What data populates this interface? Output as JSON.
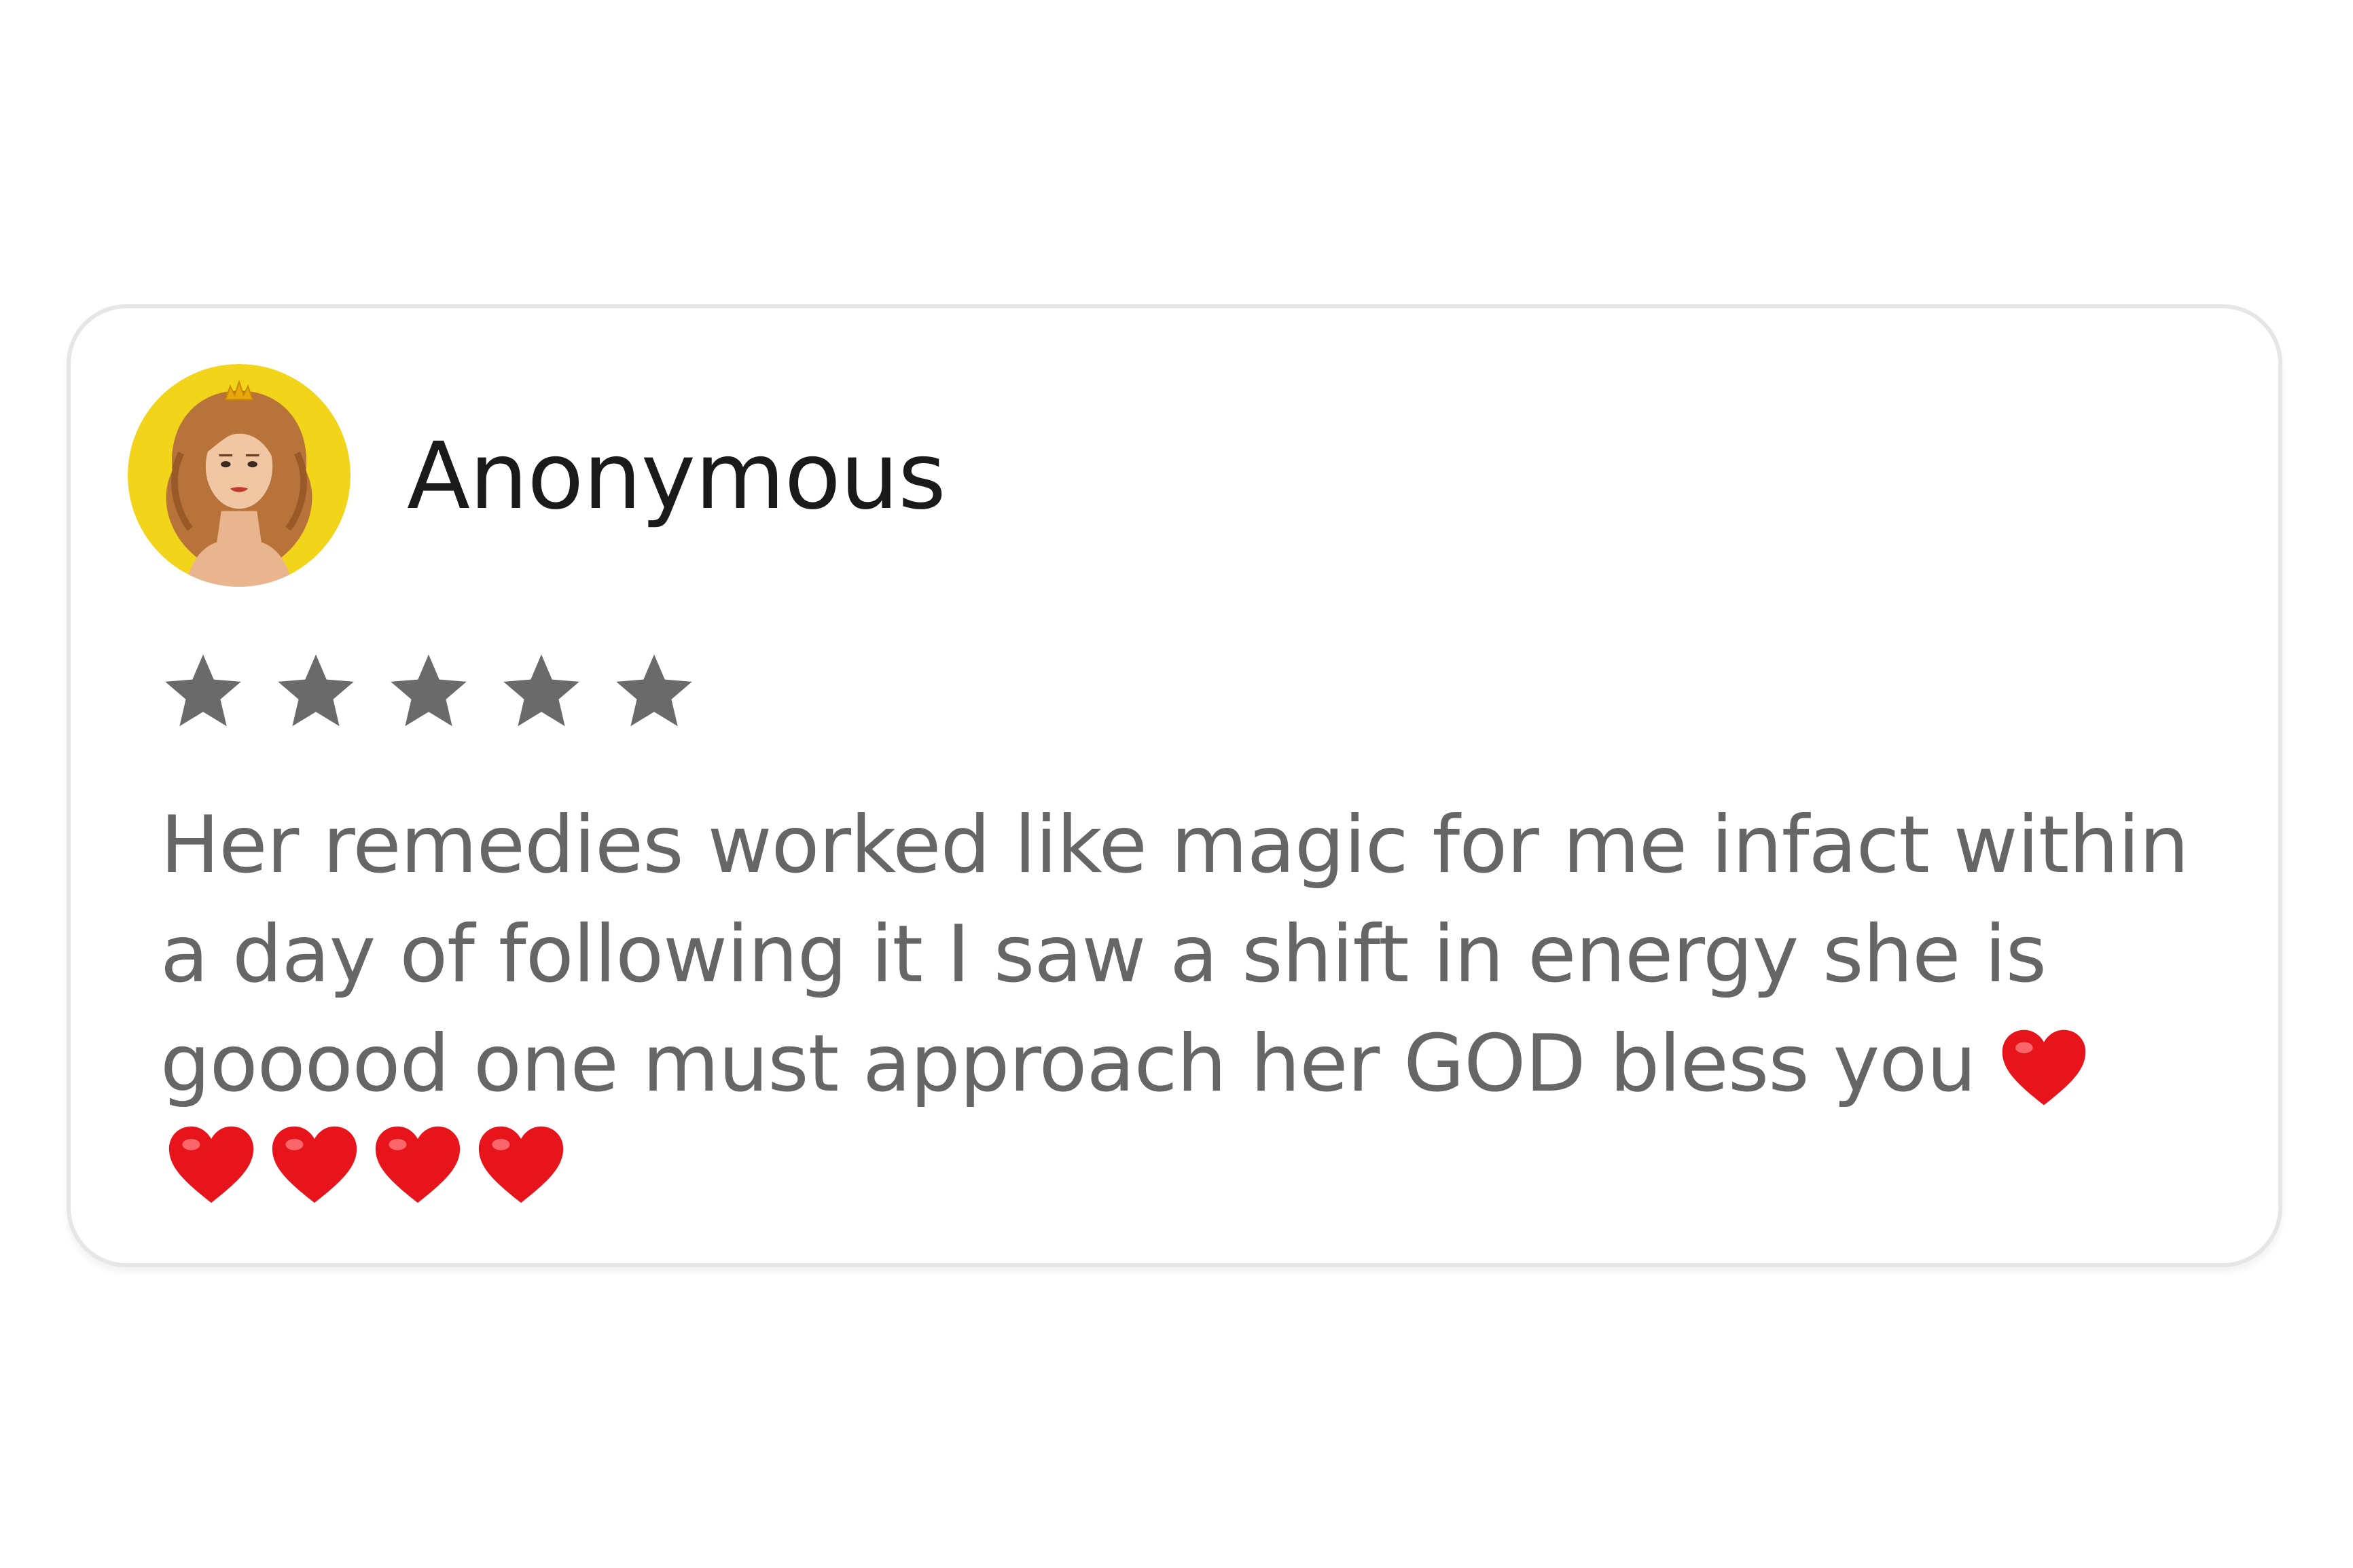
{
  "review": {
    "reviewer_name": "Anonymous",
    "rating": 5,
    "rating_max": 5,
    "text": "Her remedies worked like magic for me infact within a day of following it I saw a shift in energy she is gooood one must approach her GOD bless you",
    "trailing_emoji": "heart-icon",
    "emoji_count": 5
  },
  "colors": {
    "avatar_background": "#f2d51a",
    "star": "#6a6a6a",
    "heart": "#e8141c",
    "text": "#666666",
    "name": "#1a1a1a",
    "card_border": "#e6e6e6"
  }
}
